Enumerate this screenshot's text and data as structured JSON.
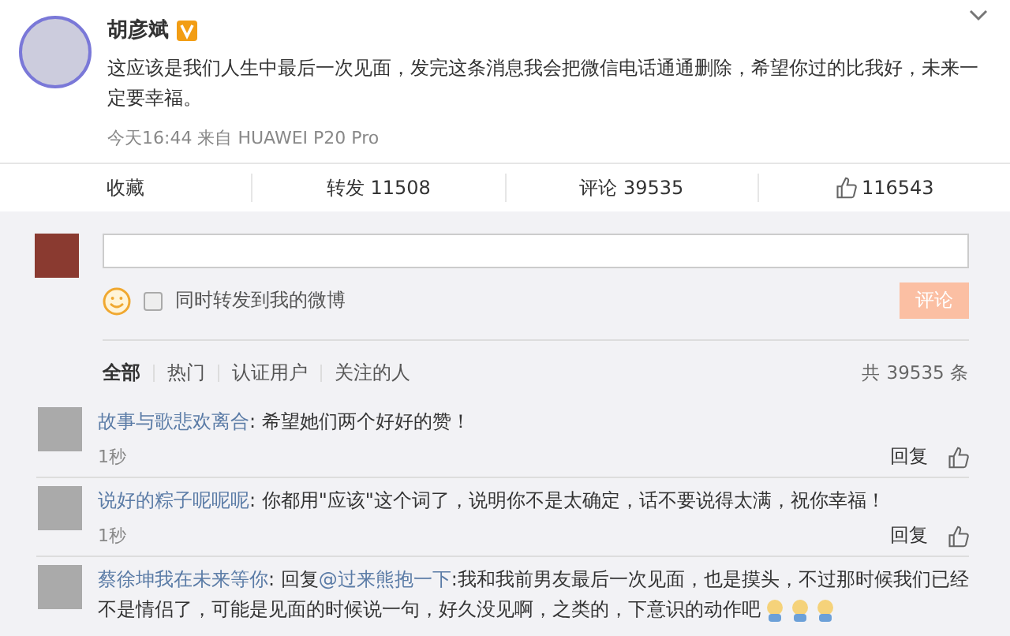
{
  "post": {
    "author": "胡彦斌",
    "verified": true,
    "text": "这应该是我们人生中最后一次见面，发完这条消息我会把微信电话通通删除，希望你过的比我好，未来一定要幸福。",
    "meta": "今天16:44 来自 HUAWEI P20 Pro"
  },
  "actions": [
    {
      "kind": "text",
      "label": "收藏"
    },
    {
      "kind": "text",
      "label": "转发 11508"
    },
    {
      "kind": "text",
      "label": "评论 39535"
    },
    {
      "kind": "like",
      "label": "116543"
    }
  ],
  "composer": {
    "share_label": "同时转发到我的微博",
    "share_checked": false,
    "submit": "评论",
    "submit_disabled": true
  },
  "tabs": [
    {
      "label": "全部",
      "selected": true
    },
    {
      "label": "热门",
      "selected": false
    },
    {
      "label": "认证用户",
      "selected": false
    },
    {
      "label": "关注的人",
      "selected": false
    }
  ],
  "total": "共 39535 条",
  "comments": [
    {
      "user": "故事与歌悲欢离合",
      "text": ": 希望她们两个好好的赞！",
      "time": "1秒",
      "reply": "回复"
    },
    {
      "user": "说好的粽子呢呢呢",
      "text": ": 你都用\"应该\"这个词了，说明你不是太确定，话不要说得太满，祝你幸福！",
      "time": "1秒",
      "reply": "回复"
    },
    {
      "user": "蔡徐坤我在未来等你",
      "prefix": ": 回复",
      "mention": "@过来熊抱一下",
      "text": ":我和我前男友最后一次见面，也是摸头，不过那时候我们已经不是情侣了，可能是见面的时候说一句，好久没见啊，之类的，下意识的动作吧",
      "emojis": [
        {
          "kind": "face"
        },
        {
          "kind": "face"
        },
        {
          "kind": "face"
        }
      ]
    }
  ]
}
